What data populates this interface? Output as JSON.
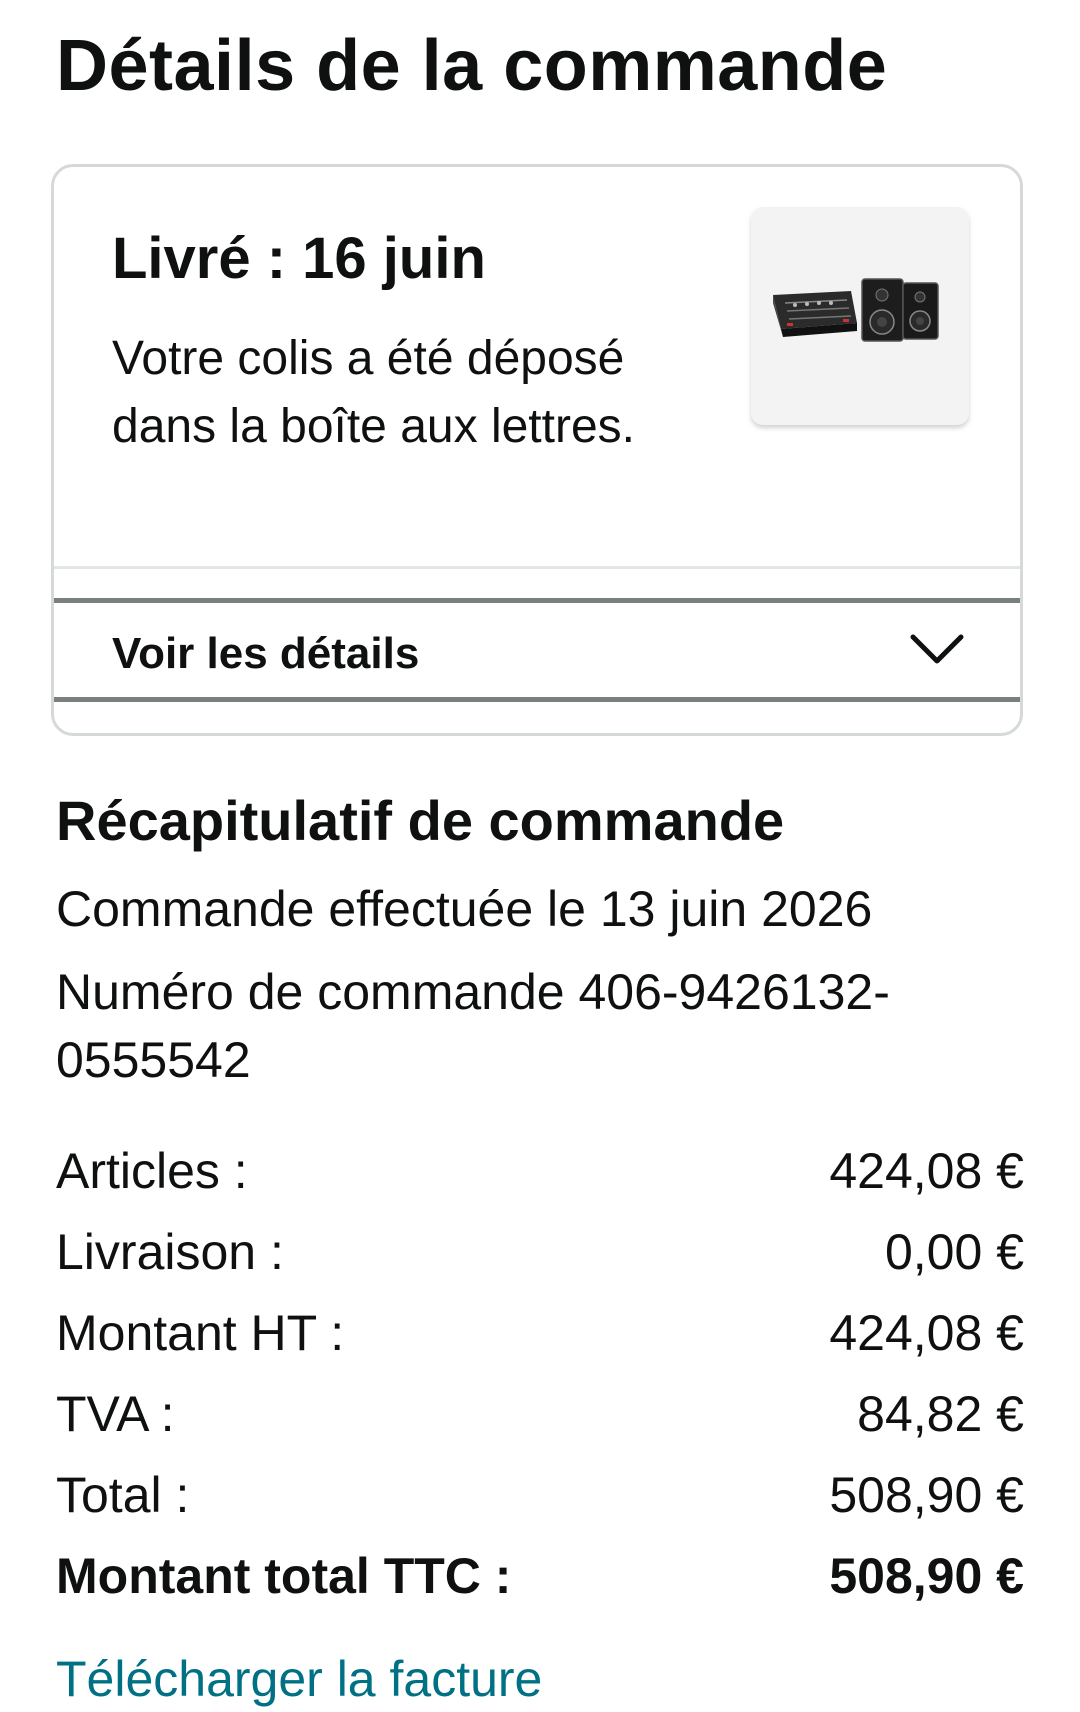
{
  "page_title": "Détails de la commande",
  "shipment": {
    "status": "Livré : 16 juin",
    "message": "Votre colis a été déposé dans la boîte aux lettres.",
    "product_image_icon": "audio-mixer-speakers-image",
    "details_toggle_label": "Voir les détails",
    "toggle_icon": "chevron-down-icon"
  },
  "summary": {
    "heading": "Récapitulatif de commande",
    "order_date": "Commande effectuée le 13 juin 2026",
    "order_number": "Numéro de commande 406-9426132-0555542",
    "rows": [
      {
        "label": "Articles :",
        "value": "424,08 €"
      },
      {
        "label": "Livraison :",
        "value": "0,00 €"
      },
      {
        "label": "Montant HT :",
        "value": "424,08 €"
      },
      {
        "label": "TVA :",
        "value": "84,82 €"
      },
      {
        "label": "Total :",
        "value": "508,90 €"
      }
    ],
    "grand_total": {
      "label": "Montant total TTC :",
      "value": "508,90 €"
    },
    "invoice_link": "Télécharger la facture"
  },
  "colors": {
    "text": "#0f1111",
    "link": "#007185",
    "border": "#d5d9d9",
    "toggle_border": "#7a7f80"
  }
}
